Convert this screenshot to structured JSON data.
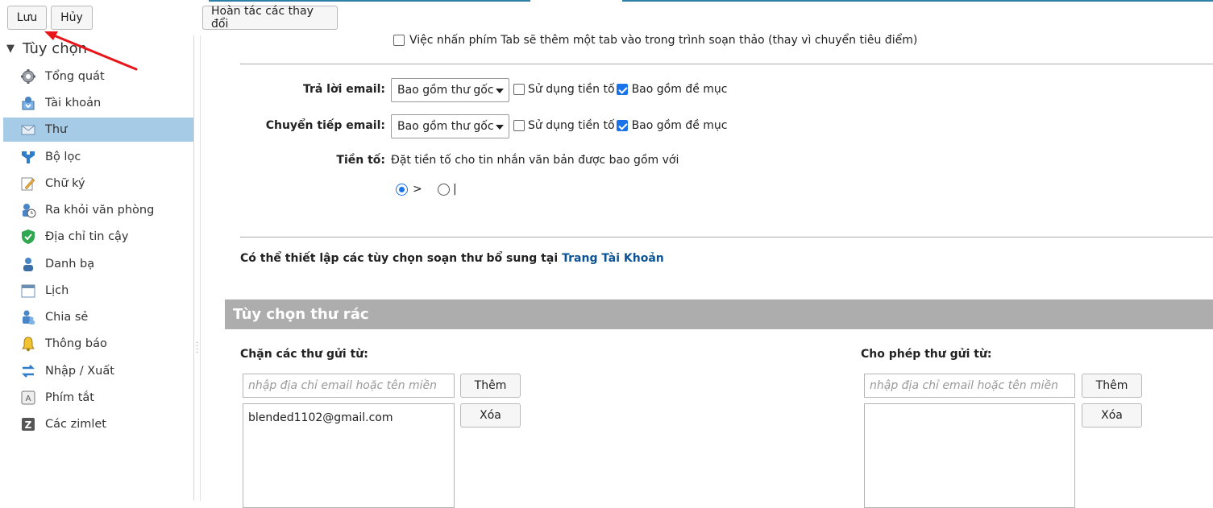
{
  "toolbar": {
    "save_label": "Lưu",
    "cancel_label": "Hủy",
    "undo_label": "Hoàn tác các thay đổi"
  },
  "sidebar": {
    "header": "Tùy chọn",
    "items": [
      {
        "label": "Tổng quát",
        "icon": "gear-icon"
      },
      {
        "label": "Tài khoản",
        "icon": "account-icon"
      },
      {
        "label": "Thư",
        "icon": "mail-icon",
        "selected": true
      },
      {
        "label": "Bộ lọc",
        "icon": "filter-icon"
      },
      {
        "label": "Chữ ký",
        "icon": "signature-icon"
      },
      {
        "label": "Ra khỏi văn phòng",
        "icon": "out-of-office-icon"
      },
      {
        "label": "Địa chỉ tin cậy",
        "icon": "shield-icon"
      },
      {
        "label": "Danh bạ",
        "icon": "contacts-icon"
      },
      {
        "label": "Lịch",
        "icon": "calendar-icon"
      },
      {
        "label": "Chia sẻ",
        "icon": "share-icon"
      },
      {
        "label": "Thông báo",
        "icon": "bell-icon"
      },
      {
        "label": "Nhập / Xuất",
        "icon": "import-export-icon"
      },
      {
        "label": "Phím tắt",
        "icon": "shortcut-icon"
      },
      {
        "label": "Các zimlet",
        "icon": "zimlet-icon"
      }
    ]
  },
  "compose": {
    "tab_option": "Việc nhấn phím Tab sẽ thêm một tab vào trong trình soạn thảo (thay vì chuyển tiêu điểm)",
    "reply_label": "Trả lời email:",
    "reply_select": "Bao gồm thư gốc",
    "forward_label": "Chuyển tiếp email:",
    "forward_select": "Bao gồm thư gốc",
    "use_prefix": "Sử dụng tiền tố",
    "include_headers": "Bao gồm đề mục",
    "prefix_label": "Tiền tố:",
    "prefix_desc": "Đặt tiền tố cho tin nhắn văn bản được bao gồm với",
    "prefix_opt1": ">",
    "prefix_opt2": "|",
    "more_options_text": "Có thể thiết lập các tùy chọn soạn thư bổ sung tại",
    "more_options_link": "Trang Tài Khoản"
  },
  "spam": {
    "section_title": "Tùy chọn thư rác",
    "block_label": "Chặn các thư gửi từ:",
    "allow_label": "Cho phép thư gửi từ:",
    "placeholder": "nhập địa chỉ email hoặc tên miền",
    "add_label": "Thêm",
    "delete_label": "Xóa",
    "blocked_list": [
      "blended1102@gmail.com"
    ]
  },
  "colors": {
    "accent": "#1a73e8",
    "selected_bg": "#a5cbe6",
    "section_bar": "#adadad",
    "link": "#0b5394",
    "annotation_arrow": "#e8161b"
  }
}
